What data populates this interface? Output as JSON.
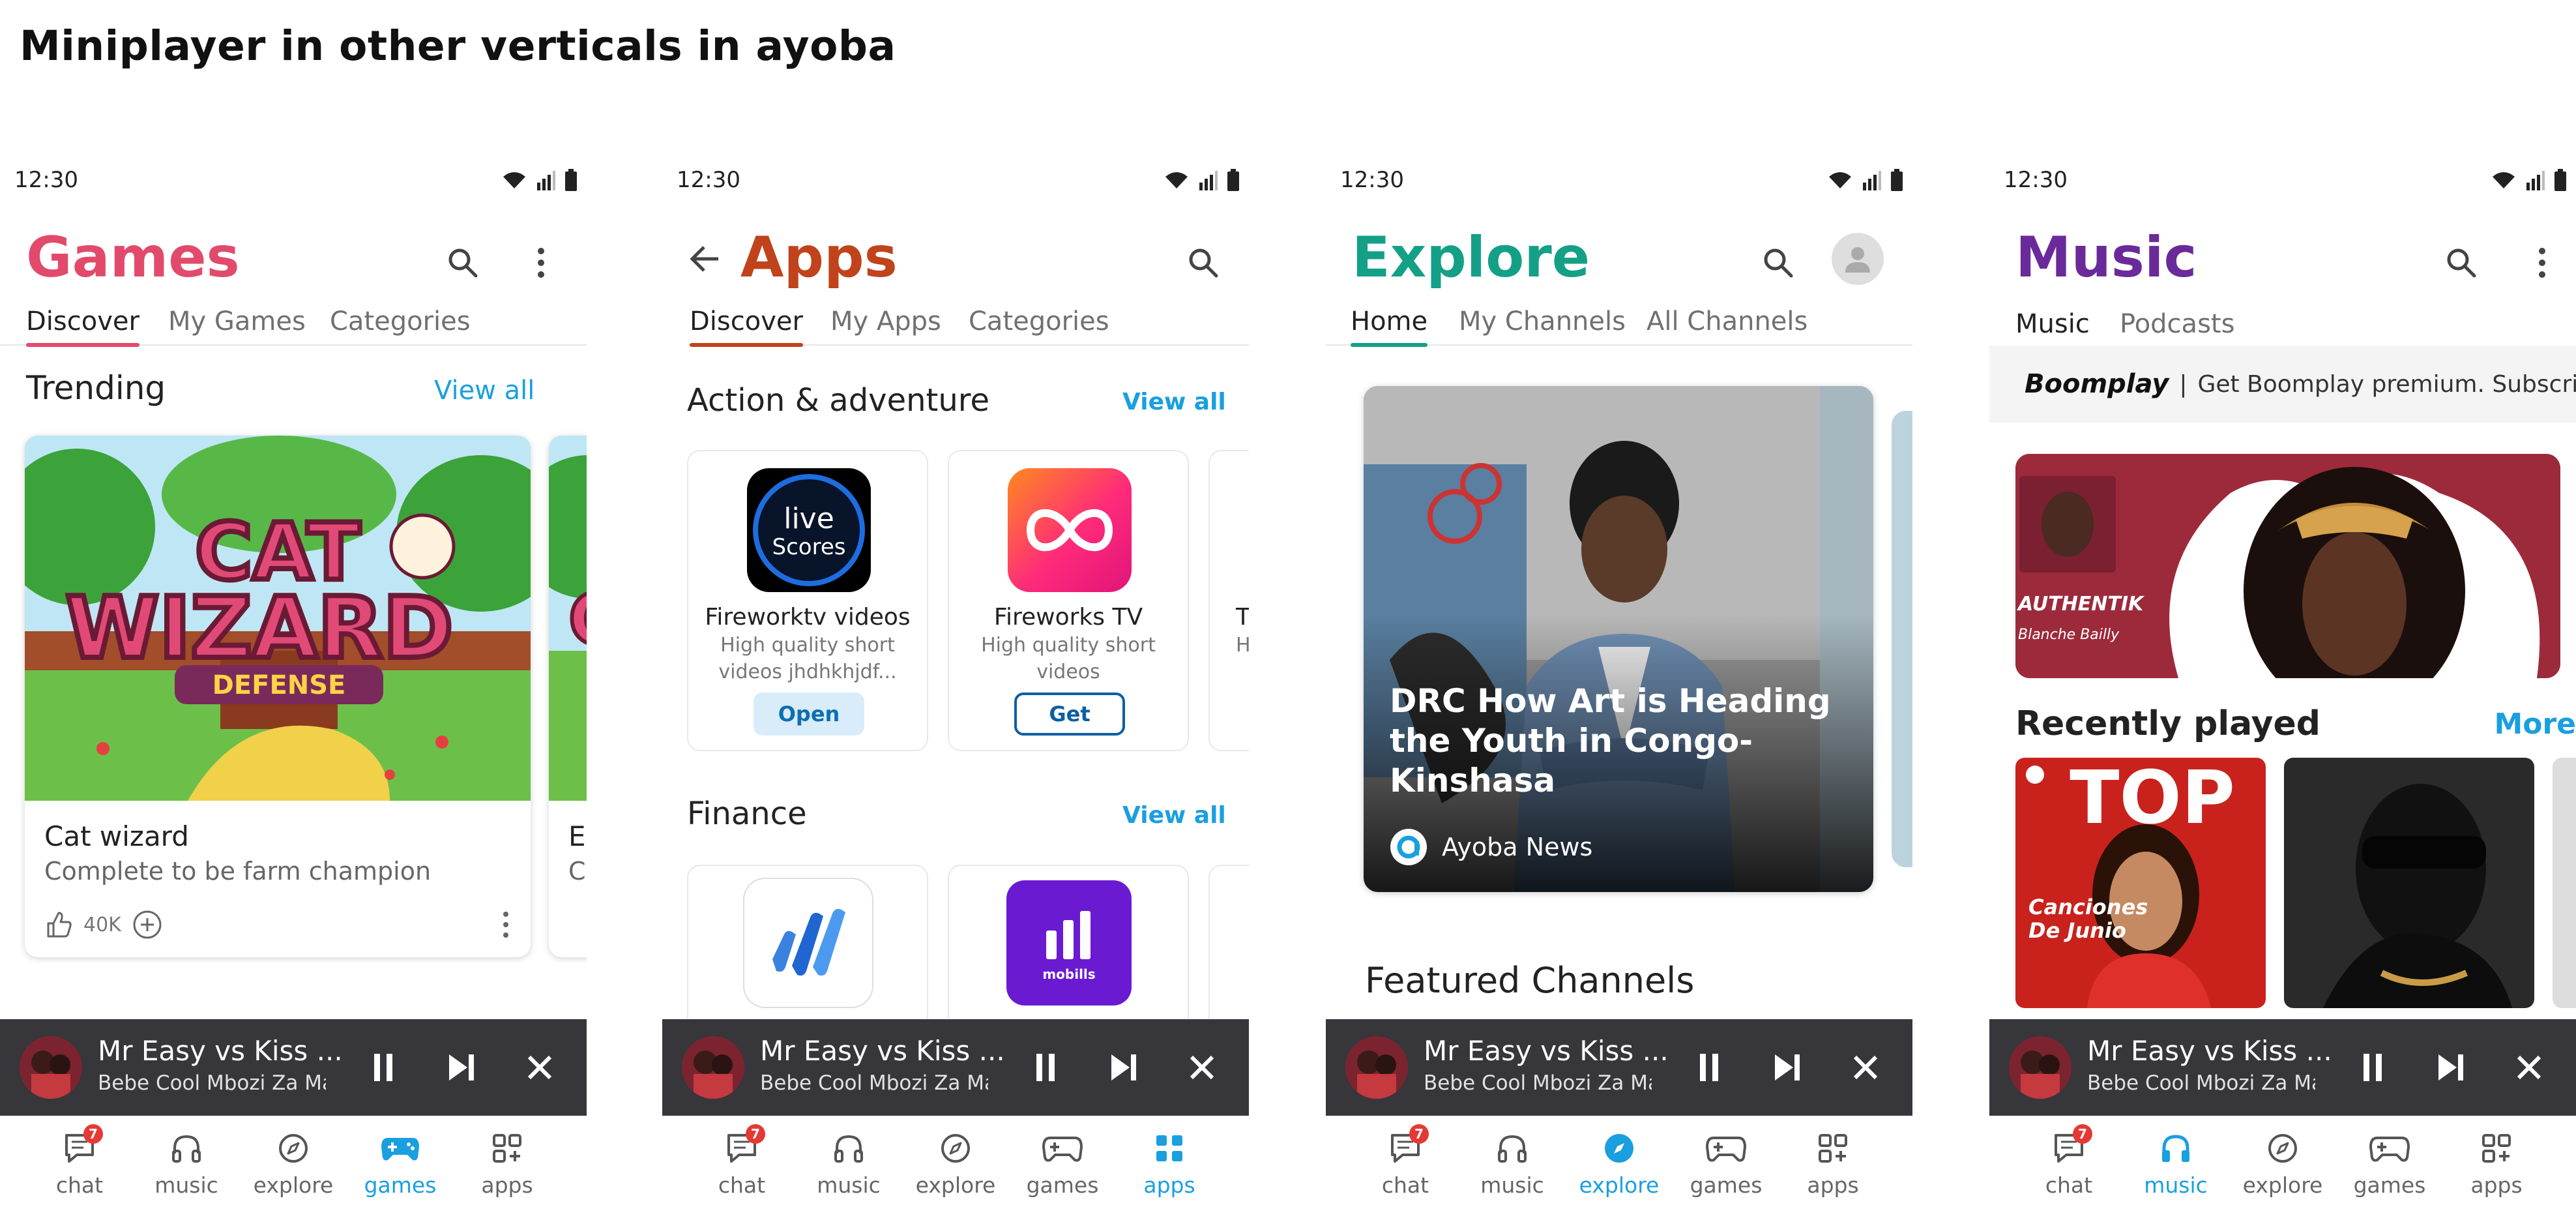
{
  "page_title": "Miniplayer in other verticals in ayoba",
  "status_time": "12:30",
  "colors": {
    "games": "#e24a6c",
    "apps": "#c0431b",
    "explore": "#14a087",
    "music": "#6a2a9a",
    "accent_blue": "#1a9fe0",
    "miniplayer_bg": "#37363b"
  },
  "miniplayer": {
    "title": "Mr Easy vs Kiss ...",
    "artist": "Bebe Cool Mbozi Za Malada"
  },
  "nav": {
    "chat": "chat",
    "music": "music",
    "explore": "explore",
    "games": "games",
    "apps": "apps",
    "chat_badge": "7"
  },
  "games": {
    "title": "Games",
    "tabs": [
      "Discover",
      "My Games",
      "Categories"
    ],
    "section": "Trending",
    "view_all": "View all",
    "card": {
      "name": "Cat wizard",
      "description": "Complete to be farm champion",
      "likes": "40K",
      "art_title_1": "CAT",
      "art_title_2": "WIZARD",
      "art_subtitle": "DEFENSE"
    },
    "peek_name": "E",
    "peek_desc": "C"
  },
  "apps": {
    "title": "Apps",
    "tabs": [
      "Discover",
      "My Apps",
      "Categories"
    ],
    "sections": [
      {
        "title": "Action & adventure",
        "view_all": "View all"
      },
      {
        "title": "Finance",
        "view_all": "View all"
      }
    ],
    "cards": [
      {
        "name": "Fireworktv videos",
        "desc": "High quality short videos jhdhkhjdf...",
        "button": "Open",
        "logo_text_1": "live",
        "logo_text_2": "Scores"
      },
      {
        "name": "Fireworks TV",
        "desc": "High quality short videos",
        "button": "Get"
      }
    ],
    "peek_name": "T",
    "peek_desc": "H",
    "finance_logo_2": "mobills"
  },
  "explore": {
    "title": "Explore",
    "tabs": [
      "Home",
      "My Channels",
      "All Channels"
    ],
    "news": {
      "title": "DRC How Art is Heading the Youth in Congo-Kinshasa",
      "source": "Ayoba News"
    },
    "featured": "Featured Channels"
  },
  "music": {
    "title": "Music",
    "tabs": [
      "Music",
      "Podcasts"
    ],
    "promo_brand": "Boomplay",
    "promo_text": "Get Boomplay premium. Subscribe",
    "banner_title": "AUTHENTIK",
    "banner_artist": "Blanche Bailly",
    "recent": "Recently played",
    "more": "More",
    "album1_title": "TOP",
    "album1_sub_1": "Canciones",
    "album1_sub_2": "De Junio"
  }
}
